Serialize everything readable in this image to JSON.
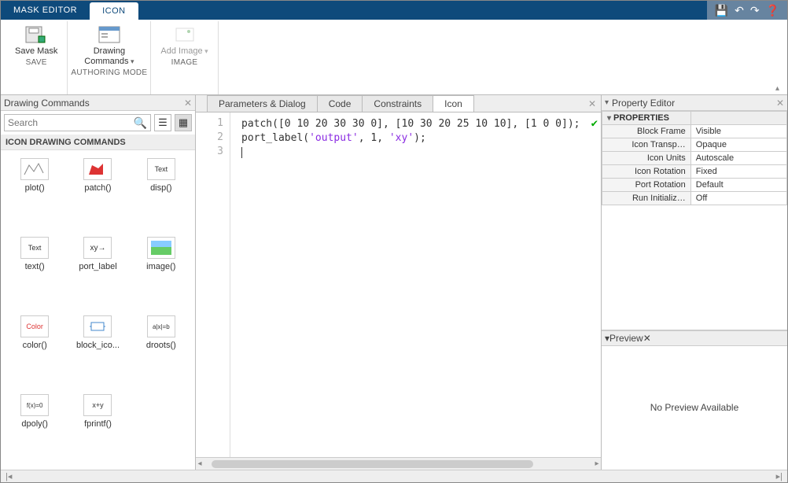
{
  "titlebar": {
    "tabs": [
      {
        "label": "MASK EDITOR",
        "active": false
      },
      {
        "label": "ICON",
        "active": true
      }
    ]
  },
  "ribbon": {
    "save_mask": "Save Mask",
    "drawing_commands": "Drawing\nCommands",
    "add_image": "Add Image",
    "group_save": "SAVE",
    "group_authoring": "AUTHORING MODE",
    "group_image": "IMAGE"
  },
  "left_panel": {
    "title": "Drawing Commands",
    "search_placeholder": "Search",
    "section": "ICON DRAWING COMMANDS",
    "commands": [
      {
        "label": "plot()"
      },
      {
        "label": "patch()"
      },
      {
        "label": "disp()"
      },
      {
        "label": "text()"
      },
      {
        "label": "port_label"
      },
      {
        "label": "image()"
      },
      {
        "label": "color()"
      },
      {
        "label": "block_ico..."
      },
      {
        "label": "droots()"
      },
      {
        "label": "dpoly()"
      },
      {
        "label": "fprintf()"
      }
    ]
  },
  "center": {
    "tabs": [
      {
        "label": "Parameters & Dialog",
        "active": false
      },
      {
        "label": "Code",
        "active": false
      },
      {
        "label": "Constraints",
        "active": false
      },
      {
        "label": "Icon",
        "active": true
      }
    ],
    "code": {
      "line1_pre": "patch([0 10 20 30 30 0], [10 30 20 25 10 10], [1 0 0]);",
      "line2_a": "port_label(",
      "line2_s1": "'output'",
      "line2_b": ", 1, ",
      "line2_s2": "'xy'",
      "line2_c": ");",
      "gutter": [
        "1",
        "2",
        "3"
      ]
    }
  },
  "right": {
    "editor_title": "Property Editor",
    "properties_label": "PROPERTIES",
    "rows": [
      {
        "key": "Block Frame",
        "val": "Visible"
      },
      {
        "key": "Icon Transp…",
        "val": "Opaque"
      },
      {
        "key": "Icon Units",
        "val": "Autoscale"
      },
      {
        "key": "Icon Rotation",
        "val": "Fixed"
      },
      {
        "key": "Port Rotation",
        "val": "Default"
      },
      {
        "key": "Run Initializ…",
        "val": "Off"
      }
    ],
    "preview_title": "Preview",
    "preview_text": "No Preview Available"
  }
}
